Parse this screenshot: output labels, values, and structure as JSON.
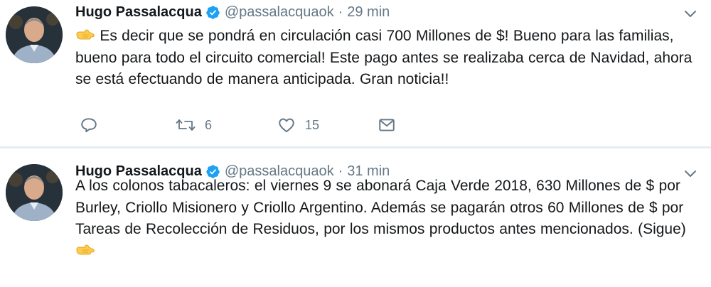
{
  "tweets": [
    {
      "author_name": "Hugo Passalacqua",
      "handle": "@passalacquaok",
      "separator": "·",
      "time": "29 min",
      "text_after_icon": "Es decir que se pondrá en circulación casi 700 Millones de $! Bueno para las familias, bueno para todo el circuito comercial! Este pago antes se realizaba cerca de Navidad, ahora se está efectuando de manera anticipada. Gran noticia!!",
      "leading_icon": "backhand-index-pointing-right-icon",
      "retweets": "6",
      "likes": "15"
    },
    {
      "author_name": "Hugo Passalacqua",
      "handle": "@passalacquaok",
      "separator": "·",
      "time": "31 min",
      "text_before_icon": "A los colonos tabacaleros: el viernes 9 se abonará Caja Verde 2018, 630 Millones de $ por Burley, Criollo Misionero y Criollo Argentino. Además se pagarán otros 60 Millones de $ por Tareas de Recolección de Residuos, por los mismos productos antes mencionados. (Sigue)",
      "trailing_icon": "backhand-index-pointing-right-icon"
    }
  ],
  "colors": {
    "text": "#14171a",
    "secondary": "#657786",
    "verified": "#1da1f2",
    "separator": "#e6ecf0",
    "emoji": "#ffcc4d"
  }
}
